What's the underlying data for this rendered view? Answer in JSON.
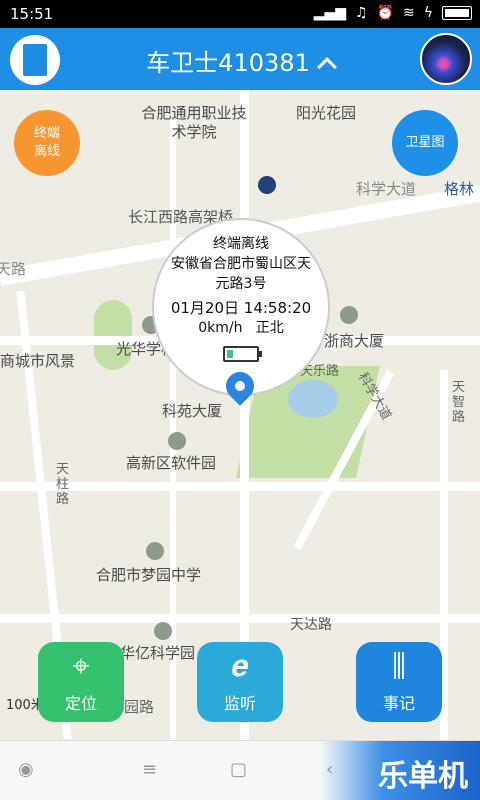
{
  "status_bar": {
    "time": "15:51",
    "icons": [
      "signal-icon",
      "mute-icon",
      "alarm-icon",
      "wifi-icon",
      "charging-icon",
      "battery-icon"
    ]
  },
  "header": {
    "title": "车卫士410381"
  },
  "map": {
    "labels": {
      "vocational": "合肥通用职业技术学院",
      "sunshine": "阳光花园",
      "science_ave": "科学大道",
      "changjiang": "长江西路高架桥",
      "tianlu": "天路",
      "guanghua": "光华学校",
      "zheshang": "浙商大厦",
      "shangcheng": "商城市风景",
      "tianle": "天乐路",
      "kexue_ave_v": "科学大道",
      "tianzhi": "天智路",
      "keyuan": "科苑大厦",
      "software": "高新区软件园",
      "tianzhu": "天柱路",
      "mengyuan": "合肥市梦园中学",
      "tianda": "天达路",
      "huayi": "华亿科学园",
      "ge": "格林",
      "yuanlu": "园路",
      "scale": "100米"
    }
  },
  "fab": {
    "offline": "终端离线",
    "satellite": "卫星图"
  },
  "bubble": {
    "status": "终端离线",
    "address": "安徽省合肥市蜀山区天元路3号",
    "datetime": "01月20日 14:58:20",
    "speed_dir": "0km/h   正北",
    "battery_level": 0.2
  },
  "actions": {
    "locate": "定位",
    "listen": "监听",
    "log": "事记"
  },
  "watermark": "乐单机",
  "colors": {
    "header": "#1f8fe5",
    "offline": "#f79530",
    "locate": "#34c06e",
    "listen": "#2ba9d8",
    "log": "#1e86dc"
  }
}
